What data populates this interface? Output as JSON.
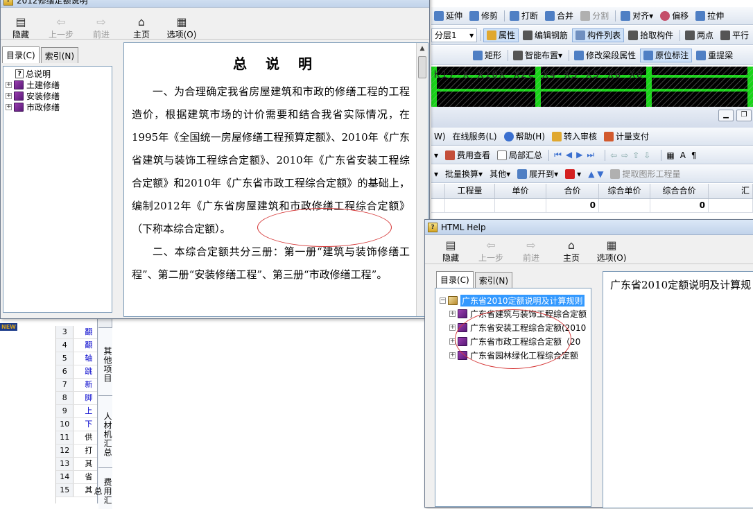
{
  "bg_app": {
    "toolbar1": [
      "延伸",
      "修剪",
      "打断",
      "合并",
      "分割",
      "对齐",
      "偏移",
      "拉伸"
    ],
    "toolbar2": {
      "layer": "分层1",
      "items": [
        "属性",
        "编辑钢筋",
        "构件列表",
        "拾取构件",
        "两点",
        "平行"
      ]
    },
    "toolbar3": [
      "矩形",
      "智能布置",
      "修改梁段属性",
      "原位标注",
      "重提梁"
    ],
    "cad_text": "K17 X X10X X2C X4 X5 X5 X6 X8",
    "menu": [
      "W)",
      "在线服务(L)",
      "帮助(H)",
      "转入审核",
      "计量支付"
    ],
    "toolbar4": [
      "费用查看",
      "局部汇总"
    ],
    "toolbar5": [
      "批量换算",
      "其他",
      "展开到",
      "提取图形工程量"
    ],
    "grid_headers": [
      "工程量",
      "单价",
      "合价",
      "综合单价",
      "综合合价",
      "汇"
    ],
    "grid_row": [
      "",
      "",
      "0",
      "",
      "0",
      ""
    ],
    "row_numbers": [
      "3",
      "4",
      "5",
      "6",
      "7",
      "8",
      "9",
      "10",
      "11",
      "12",
      "13",
      "14",
      "15"
    ],
    "row_texts": [
      "翻",
      "翻",
      "轴",
      "跳",
      "新",
      "脚",
      "上",
      "下",
      "供",
      "打",
      "其",
      "省",
      "其"
    ],
    "vtabs": [
      "其他项目",
      "人材机汇总",
      "费用汇总"
    ],
    "new_badge": "NEW"
  },
  "win1": {
    "title": "2012修缮定额说明",
    "buttons": [
      {
        "label": "隐藏",
        "glyph": "▤",
        "disabled": false
      },
      {
        "label": "上一步",
        "glyph": "⇦",
        "disabled": true
      },
      {
        "label": "前进",
        "glyph": "⇨",
        "disabled": true
      },
      {
        "label": "主页",
        "glyph": "⌂",
        "disabled": false
      },
      {
        "label": "选项(O)",
        "glyph": "▦",
        "disabled": false
      }
    ],
    "tabs": [
      "目录(C)",
      "索引(N)"
    ],
    "tree": [
      "总说明",
      "土建修缮",
      "安装修缮",
      "市政修缮"
    ],
    "doc_title": "总 说 明",
    "para1": "一、为合理确定我省房屋建筑和市政的修缮工程的工程造价，根据建筑市场的计价需要和结合我省实际情况，在1995年《全国统一房屋修缮工程预算定额》、2010年《广东省建筑与装饰工程综合定额》、2010年《广东省安装工程综合定额》和2010年《广东省市政工程综合定额》的基础上，编制2012年《广东省房屋建筑和市政修缮工程综合定额》（下称本综合定额）。",
    "para2": "二、本综合定额共分三册：第一册“建筑与装饰修缮工程”、第二册“安装修缮工程”、第三册“市政修缮工程”。"
  },
  "win2": {
    "title": "HTML Help",
    "buttons": [
      {
        "label": "隐藏",
        "glyph": "▤",
        "disabled": false
      },
      {
        "label": "上一步",
        "glyph": "⇦",
        "disabled": true
      },
      {
        "label": "前进",
        "glyph": "⇨",
        "disabled": true
      },
      {
        "label": "主页",
        "glyph": "⌂",
        "disabled": false
      },
      {
        "label": "选项(O)",
        "glyph": "▦",
        "disabled": false
      }
    ],
    "tabs": [
      "目录(C)",
      "索引(N)"
    ],
    "tree_root": "广东省2010定额说明及计算规则",
    "tree": [
      "广东省建筑与装饰工程综合定额",
      "广东省安装工程综合定额(2010",
      "广东省市政工程综合定额（20",
      "广东省园林绿化工程综合定额"
    ],
    "content_text": "广东省2010定额说明及计算规"
  }
}
